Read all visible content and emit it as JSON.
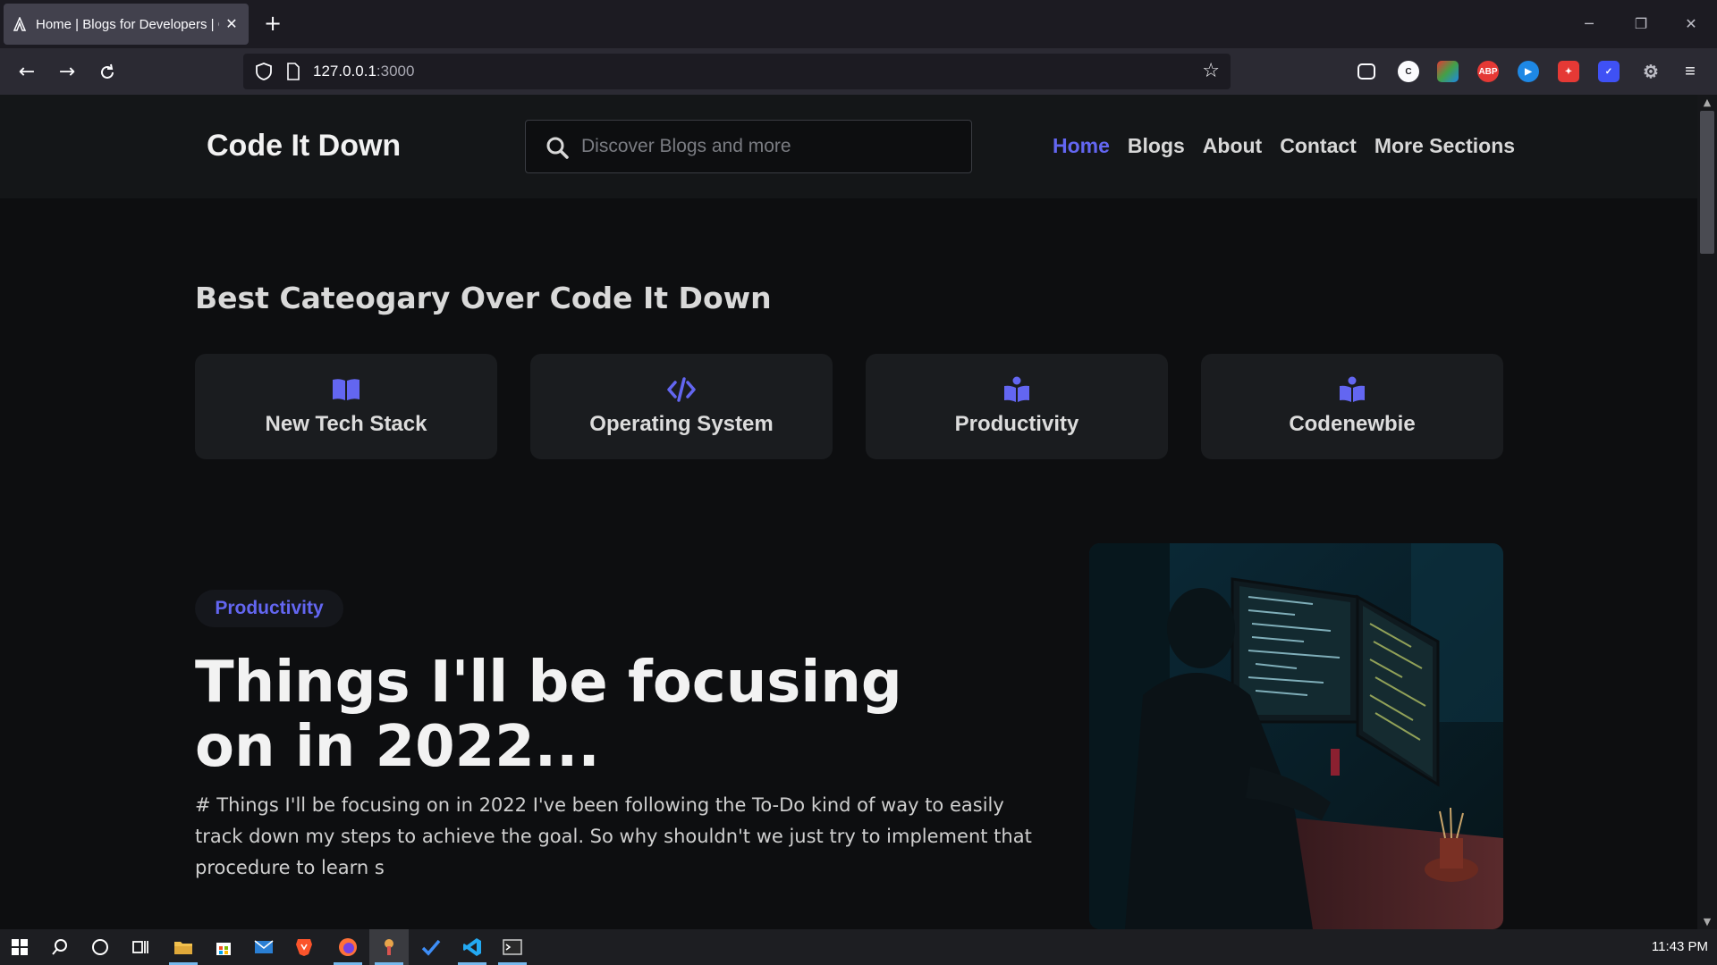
{
  "browser": {
    "tab_title": "Home | Blogs for Developers | C",
    "url_host": "127.0.0.1",
    "url_port": ":3000"
  },
  "site": {
    "logo": "Code It Down",
    "search_placeholder": "Discover Blogs and more",
    "nav": [
      {
        "label": "Home",
        "active": true
      },
      {
        "label": "Blogs"
      },
      {
        "label": "About"
      },
      {
        "label": "Contact"
      },
      {
        "label": "More Sections"
      }
    ],
    "accent_color": "#6366f1"
  },
  "categories": {
    "title": "Best Cateogary Over Code It Down",
    "items": [
      {
        "label": "New Tech Stack",
        "icon": "book-open-icon"
      },
      {
        "label": "Operating System",
        "icon": "code-icon"
      },
      {
        "label": "Productivity",
        "icon": "reader-icon"
      },
      {
        "label": "Codenewbie",
        "icon": "reader-icon"
      }
    ]
  },
  "featured_post": {
    "tag": "Productivity",
    "title": "Things I'll be focusing on in 2022...",
    "excerpt": "# Things I'll be focusing on in 2022  I've been following the To-Do kind of way to easily track down my steps to achieve the goal. So why shouldn't we just try to implement that procedure to learn s",
    "image": "developer-at-dark-desk-image"
  },
  "taskbar": {
    "clock": "11:43 PM"
  }
}
